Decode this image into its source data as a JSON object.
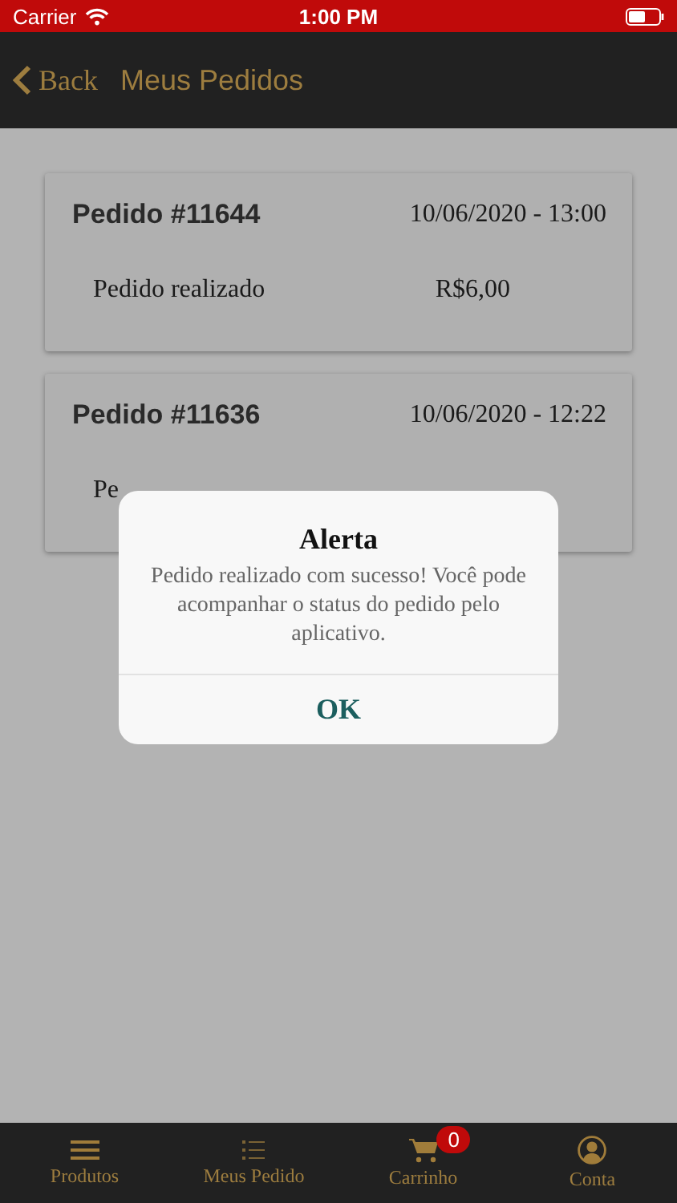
{
  "status_bar": {
    "carrier": "Carrier",
    "time": "1:00 PM"
  },
  "nav": {
    "back": "Back",
    "title": "Meus Pedidos"
  },
  "orders": [
    {
      "number": "Pedido #11644",
      "date": "10/06/2020 - 13:00",
      "status": "Pedido realizado",
      "total": "R$6,00"
    },
    {
      "number": "Pedido #11636",
      "date": "10/06/2020 - 12:22",
      "status": "Pe"
    }
  ],
  "alert": {
    "title": "Alerta",
    "message": "Pedido realizado com sucesso! Você pode acompanhar o status do pedido pelo aplicativo.",
    "button": "OK"
  },
  "tabs": [
    {
      "kind": "menu",
      "label": "Produtos"
    },
    {
      "kind": "list",
      "label": "Meus Pedido"
    },
    {
      "kind": "cart",
      "label": "Carrinho",
      "badge": "0"
    },
    {
      "kind": "account",
      "label": "Conta"
    }
  ]
}
